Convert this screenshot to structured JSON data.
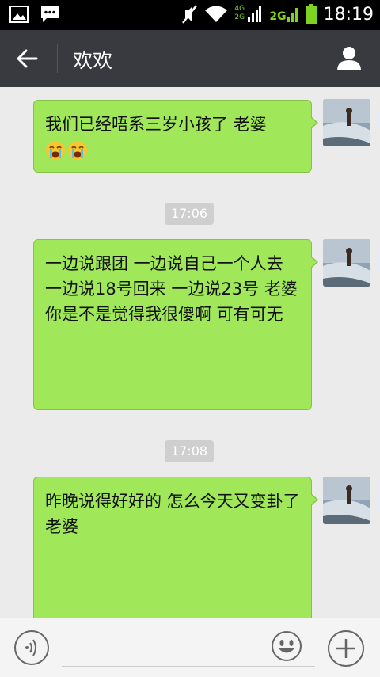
{
  "status_bar": {
    "time": "18:19",
    "network_top": "4G",
    "network_bottom": "2G",
    "network2": "2G"
  },
  "header": {
    "title": "欢欢"
  },
  "messages": [
    {
      "text": "我们已经唔系三岁小孩了 老婆",
      "emoji": [
        "crying-face-icon",
        "crying-face-icon"
      ]
    },
    {
      "timestamp": "17:06"
    },
    {
      "text": "一边说跟团 一边说自己一个人去 一边说18号回来 一边说23号 老婆 你是不是觉得我很傻啊 可有可无"
    },
    {
      "timestamp": "17:08"
    },
    {
      "text": "昨晚说得好好的 怎么今天又变卦了 老婆"
    }
  ],
  "colors": {
    "bubble": "#a0e759",
    "header": "#393a3f",
    "background": "#ebebeb"
  }
}
